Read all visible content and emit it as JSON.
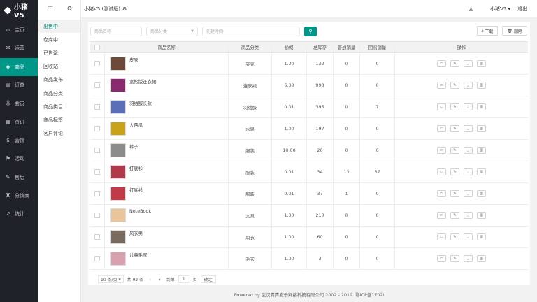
{
  "brand": {
    "name": "小猪V5"
  },
  "sidebar": {
    "items": [
      {
        "label": "主页",
        "icon": "⌂",
        "active": false
      },
      {
        "label": "运营",
        "icon": "✉",
        "active": false
      },
      {
        "label": "商品",
        "icon": "◈",
        "active": true
      },
      {
        "label": "订单",
        "icon": "▤",
        "active": false
      },
      {
        "label": "会员",
        "icon": "☺",
        "active": false
      },
      {
        "label": "资讯",
        "icon": "▦",
        "active": false
      },
      {
        "label": "营销",
        "icon": "$",
        "active": false
      },
      {
        "label": "活动",
        "icon": "⚑",
        "active": false
      },
      {
        "label": "售后",
        "icon": "✎",
        "active": false
      },
      {
        "label": "分销商",
        "icon": "♜",
        "active": false
      },
      {
        "label": "统计",
        "icon": "↗",
        "active": false
      }
    ]
  },
  "subnav": {
    "items": [
      {
        "label": "出售中",
        "active": true
      },
      {
        "label": "仓库中",
        "active": false
      },
      {
        "label": "已售罄",
        "active": false
      },
      {
        "label": "回收站",
        "active": false
      },
      {
        "label": "商品发布",
        "active": false
      },
      {
        "label": "商品分类",
        "active": false
      },
      {
        "label": "商品类目",
        "active": false
      },
      {
        "label": "商品标签",
        "active": false
      },
      {
        "label": "客户评论",
        "active": false
      }
    ]
  },
  "header": {
    "title": "小猪V5 (测试版)",
    "user": "小猪V5 ▾",
    "logout": "退出"
  },
  "filters": {
    "name_placeholder": "商品名称",
    "category_placeholder": "商品分类",
    "time_placeholder": "创建时间"
  },
  "actions": {
    "download": "下载",
    "delete": "删除"
  },
  "table": {
    "columns": [
      "商品名称",
      "商品分类",
      "价格",
      "总库存",
      "普通销量",
      "团购销量",
      "操作"
    ],
    "rows": [
      {
        "name": "皮衣",
        "category": "夹克",
        "price": "1.00",
        "stock": "132",
        "sales": "0",
        "group_sales": "0",
        "thumb": "#6b4a3a"
      },
      {
        "name": "宽松版连衣裙",
        "category": "连衣裙",
        "price": "6.00",
        "stock": "998",
        "sales": "0",
        "group_sales": "0",
        "thumb": "#8a2a6e"
      },
      {
        "name": "羽绒服长款",
        "category": "羽绒服",
        "price": "0.01",
        "stock": "395",
        "sales": "0",
        "group_sales": "7",
        "thumb": "#5a6fb8"
      },
      {
        "name": "大西瓜",
        "category": "水果",
        "price": "1.00",
        "stock": "197",
        "sales": "0",
        "group_sales": "0",
        "thumb": "#c9a21a"
      },
      {
        "name": "裤子",
        "category": "服装",
        "price": "10.00",
        "stock": "26",
        "sales": "0",
        "group_sales": "0",
        "thumb": "#8c8c8c"
      },
      {
        "name": "打底衫",
        "category": "服装",
        "price": "0.01",
        "stock": "34",
        "sales": "13",
        "group_sales": "37",
        "thumb": "#b03a4a"
      },
      {
        "name": "打底衫",
        "category": "服装",
        "price": "0.01",
        "stock": "37",
        "sales": "1",
        "group_sales": "0",
        "thumb": "#c03a48"
      },
      {
        "name": "NoteBook",
        "category": "文具",
        "price": "1.00",
        "stock": "210",
        "sales": "0",
        "group_sales": "0",
        "thumb": "#e8c59a"
      },
      {
        "name": "风衣男",
        "category": "风衣",
        "price": "1.00",
        "stock": "60",
        "sales": "0",
        "group_sales": "0",
        "thumb": "#7a6a5e"
      },
      {
        "name": "儿童毛衣",
        "category": "毛衣",
        "price": "1.00",
        "stock": "3",
        "sales": "0",
        "group_sales": "0",
        "thumb": "#d9a0b0"
      }
    ]
  },
  "pager": {
    "page_size": "10 条/页",
    "total": "共 92 条",
    "goto_label": "到第",
    "current": "1",
    "page_unit": "页",
    "confirm": "确定"
  },
  "footer": {
    "text": "Powered by 武汉青青麦子网络科技有限公司 2002 - 2019. 鄂ICP备1702l"
  }
}
